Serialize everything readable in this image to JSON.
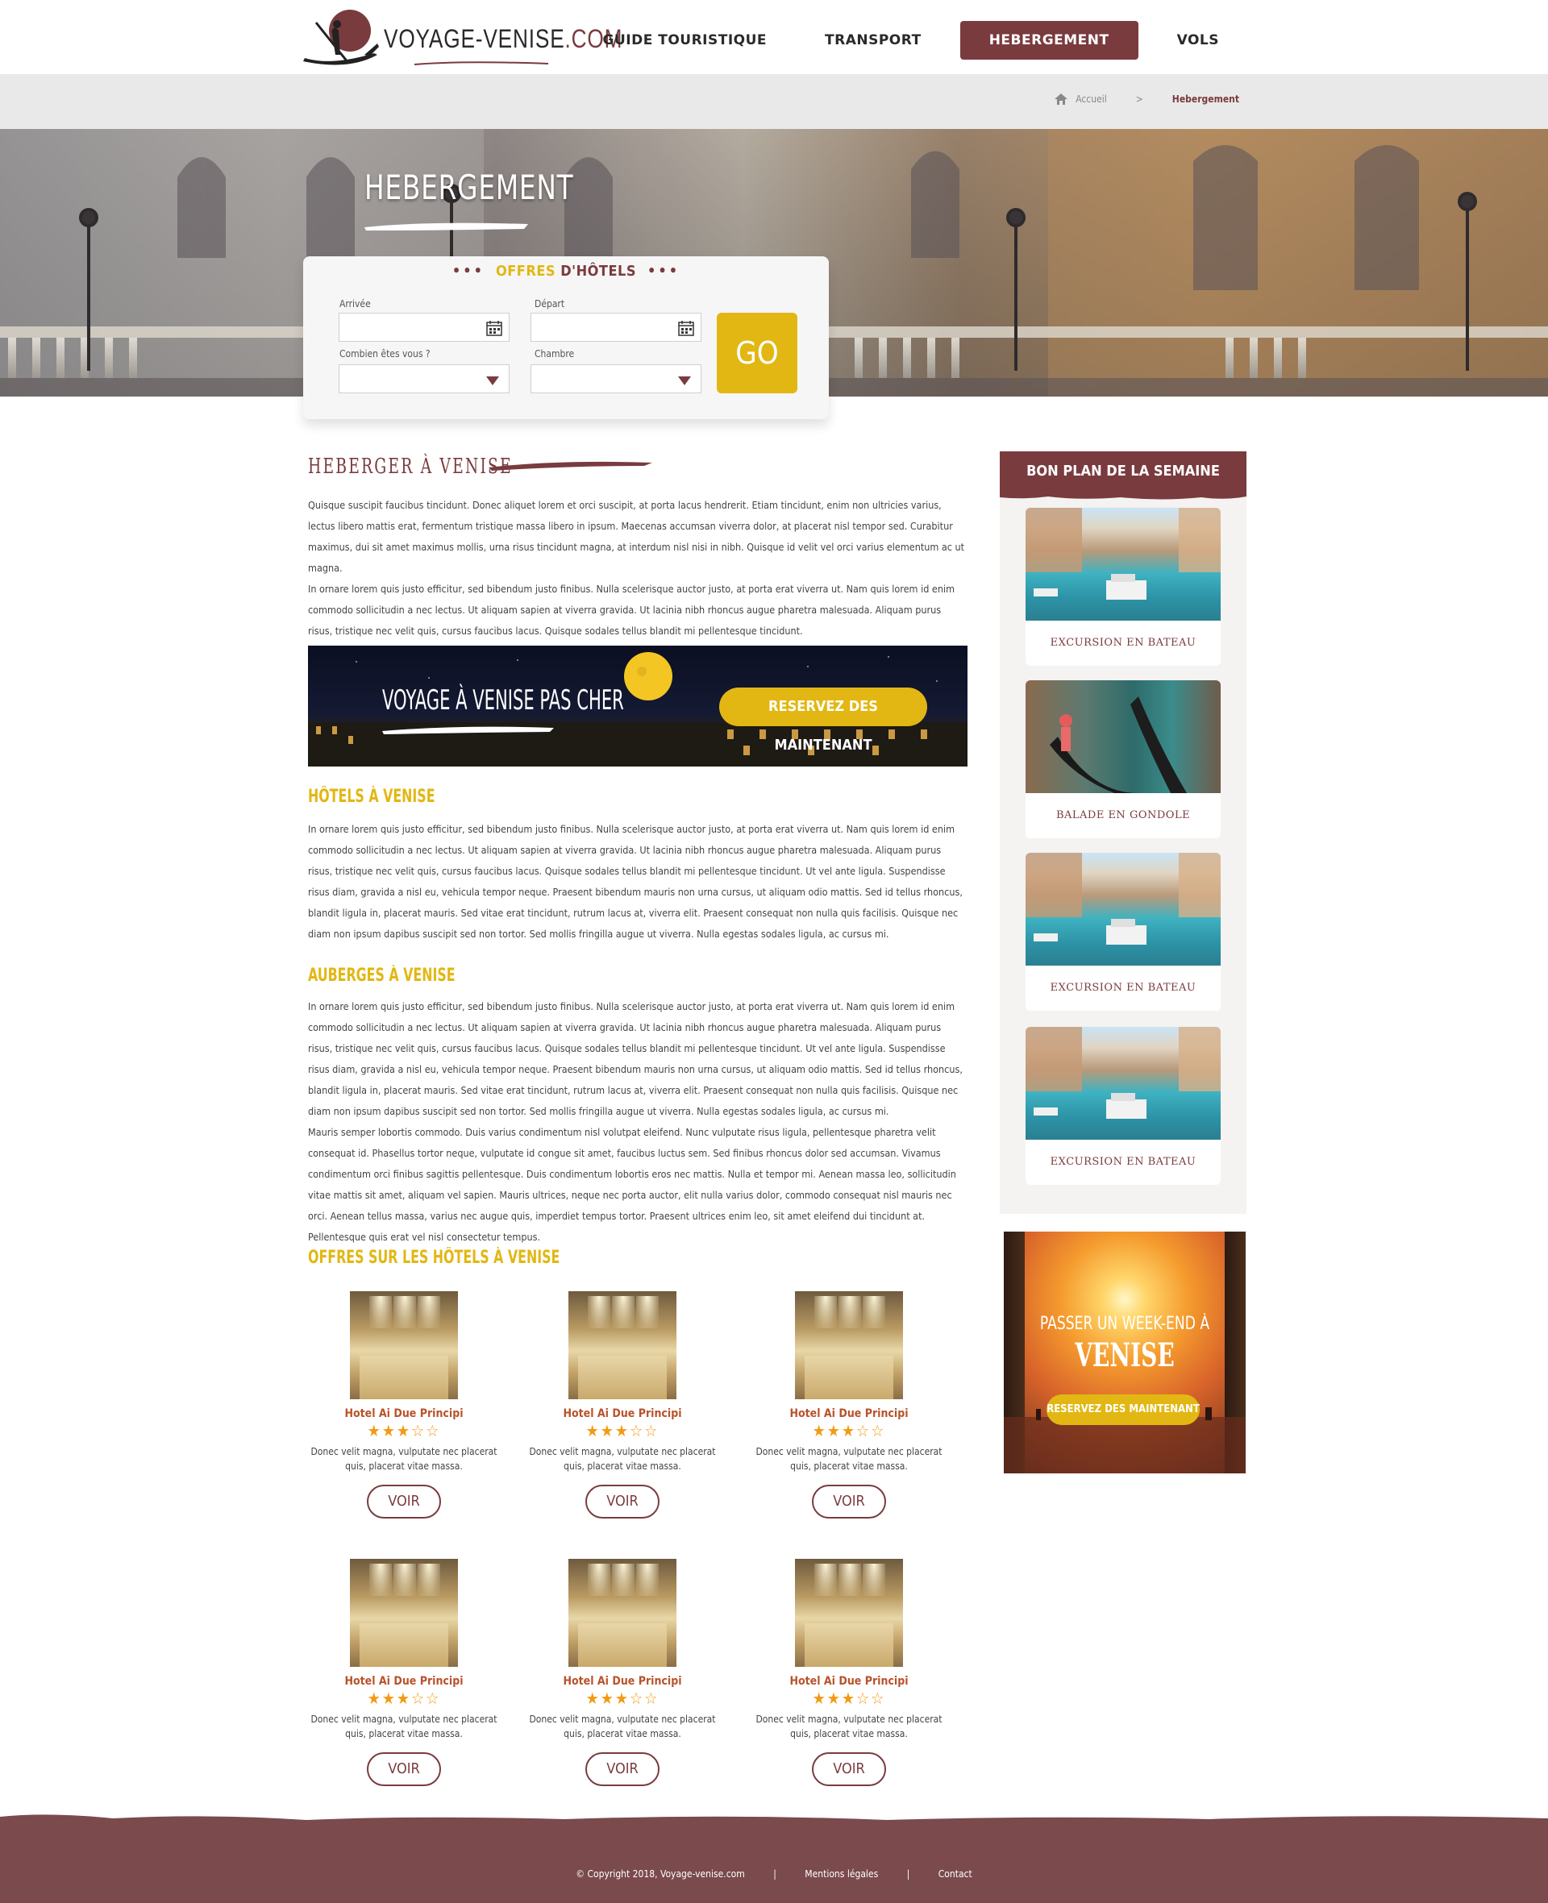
{
  "header": {
    "logo_text": "VOYAGE-VENISE",
    "logo_tld": ".COM",
    "nav": [
      {
        "label": "GUIDE TOURISTIQUE"
      },
      {
        "label": "TRANSPORT"
      },
      {
        "label": "HEBERGEMENT",
        "active": true
      },
      {
        "label": "VOLS"
      }
    ]
  },
  "breadcrumb": {
    "home": "Accueil",
    "separator": ">",
    "current": "Hebergement"
  },
  "hero": {
    "title": "HEBERGEMENT"
  },
  "search": {
    "title_highlight": "OFFRES",
    "title_rest": "D'HÔTELS",
    "dots": "•••",
    "arrival_label": "Arrivée",
    "departure_label": "Départ",
    "people_label": "Combien êtes vous ?",
    "room_label": "Chambre",
    "go_label": "GO"
  },
  "main": {
    "heading": "HEBERGER À VENISE",
    "intro": [
      "Quisque suscipit faucibus tincidunt. Donec aliquet lorem et orci suscipit, at porta lacus hendrerit. Etiam tincidunt, enim non ultricies varius, lectus libero mattis erat, fermentum tristique massa libero in ipsum. Maecenas accumsan viverra dolor, at placerat nisl tempor sed. Curabitur maximus, dui sit amet maximus mollis, urna risus tincidunt magna, at interdum nisl nisi in nibh. Quisque id velit vel orci varius elementum ac ut magna.",
      "In ornare lorem quis justo efficitur, sed bibendum justo finibus. Nulla scelerisque auctor justo, at porta erat viverra ut. Nam quis lorem id enim commodo sollicitudin a nec lectus. Ut aliquam sapien at viverra gravida. Ut lacinia nibh rhoncus augue pharetra malesuada. Aliquam purus risus, tristique nec velit quis, cursus faucibus lacus. Quisque sodales tellus blandit mi pellentesque tincidunt."
    ],
    "banner_text": "VOYAGE À VENISE PAS CHER",
    "banner_button": "RESERVEZ DES MAINTENANT",
    "hotels_heading": "HÔTELS À VENISE",
    "hotels_text": "In ornare lorem quis justo efficitur, sed bibendum justo finibus. Nulla scelerisque auctor justo, at porta erat viverra ut. Nam quis lorem id enim commodo sollicitudin a nec lectus. Ut aliquam sapien at viverra gravida. Ut lacinia nibh rhoncus augue pharetra malesuada. Aliquam purus risus, tristique nec velit quis, cursus faucibus lacus. Quisque sodales tellus blandit mi pellentesque tincidunt. Ut vel ante ligula. Suspendisse risus diam, gravida a nisl eu, vehicula tempor neque. Praesent bibendum mauris non urna cursus, ut aliquam odio mattis. Sed id tellus rhoncus, blandit ligula in, placerat mauris. Sed vitae erat tincidunt, rutrum lacus at, viverra elit. Praesent consequat non nulla quis facilisis. Quisque nec diam non ipsum dapibus suscipit sed non tortor. Sed mollis fringilla augue ut viverra. Nulla egestas sodales ligula, ac cursus mi.",
    "auberges_heading": "AUBERGES À VENISE",
    "auberges_text_1": "In ornare lorem quis justo efficitur, sed bibendum justo finibus. Nulla scelerisque auctor justo, at porta erat viverra ut. Nam quis lorem id enim commodo sollicitudin a nec lectus. Ut aliquam sapien at viverra gravida. Ut lacinia nibh rhoncus augue pharetra malesuada. Aliquam purus risus, tristique nec velit quis, cursus faucibus lacus. Quisque sodales tellus blandit mi pellentesque tincidunt. Ut vel ante ligula. Suspendisse risus diam, gravida a nisl eu, vehicula tempor neque. Praesent bibendum mauris non urna cursus, ut aliquam odio mattis. Sed id tellus rhoncus, blandit ligula in, placerat mauris. Sed vitae erat tincidunt, rutrum lacus at, viverra elit. Praesent consequat non nulla quis facilisis. Quisque nec diam non ipsum dapibus suscipit sed non tortor. Sed mollis fringilla augue ut viverra. Nulla egestas sodales ligula, ac cursus mi.",
    "auberges_text_2": "Mauris semper lobortis commodo. Duis varius condimentum nisl volutpat eleifend. Nunc vulputate risus ligula, pellentesque pharetra velit consequat id. Phasellus tortor neque, vulputate id congue sit amet, faucibus luctus sem. Sed finibus rhoncus dolor sed accumsan. Vivamus condimentum orci finibus sagittis pellentesque. Duis condimentum lobortis eros nec mattis. Nulla et tempor mi. Aenean massa leo, sollicitudin vitae mattis sit amet, aliquam vel sapien. Mauris ultrices, neque nec porta auctor, elit nulla varius dolor, commodo consequat nisl mauris nec orci. Aenean tellus massa, varius nec augue quis, imperdiet tempus tortor. Praesent ultrices enim leo, sit amet eleifend dui tincidunt at. Pellentesque quis erat vel nisl consectetur tempus.",
    "offers_heading": "OFFRES SUR LES HÔTELS  À VENISE",
    "hotels": [
      {
        "name": "Hotel Ai Due Principi",
        "stars": "★★★☆☆",
        "rating": 3,
        "desc": "Donec velit magna, vulputate nec placerat quis, placerat vitae massa.",
        "button": "VOIR"
      },
      {
        "name": "Hotel Ai Due Principi",
        "stars": "★★★☆☆",
        "rating": 3,
        "desc": "Donec velit magna, vulputate nec placerat quis, placerat vitae massa.",
        "button": "VOIR"
      },
      {
        "name": "Hotel Ai Due Principi",
        "stars": "★★★☆☆",
        "rating": 3,
        "desc": "Donec velit magna, vulputate nec placerat quis, placerat vitae massa.",
        "button": "VOIR"
      },
      {
        "name": "Hotel Ai Due Principi",
        "stars": "★★★☆☆",
        "rating": 3,
        "desc": "Donec velit magna, vulputate nec placerat quis, placerat vitae massa.",
        "button": "VOIR"
      },
      {
        "name": "Hotel Ai Due Principi",
        "stars": "★★★☆☆",
        "rating": 3,
        "desc": "Donec velit magna, vulputate nec placerat quis, placerat vitae massa.",
        "button": "VOIR"
      },
      {
        "name": "Hotel Ai Due Principi",
        "stars": "★★★☆☆",
        "rating": 3,
        "desc": "Donec velit magna, vulputate nec placerat quis, placerat vitae massa.",
        "button": "VOIR"
      }
    ]
  },
  "sidebar": {
    "title": "BON PLAN DE LA SEMAINE",
    "items": [
      {
        "caption": "EXCURSION EN BATEAU",
        "image": "canal"
      },
      {
        "caption": "BALADE EN GONDOLE",
        "image": "gondola"
      },
      {
        "caption": "EXCURSION EN BATEAU",
        "image": "canal"
      },
      {
        "caption": "EXCURSION EN BATEAU",
        "image": "canal"
      }
    ],
    "promo": {
      "title": "PASSER UN WEEK-END À",
      "city": "VENISE",
      "button": "RESERVEZ DES MAINTENANT"
    }
  },
  "footer": {
    "copyright": "© Copyright 2018, Voyage-venise.com",
    "sep": "|",
    "legal": "Mentions légales",
    "contact": "Contact"
  },
  "colors": {
    "brand": "#7a3b3e",
    "accent": "#e2b713",
    "stars": "#f29a12",
    "hotel_name": "#b8522a"
  }
}
